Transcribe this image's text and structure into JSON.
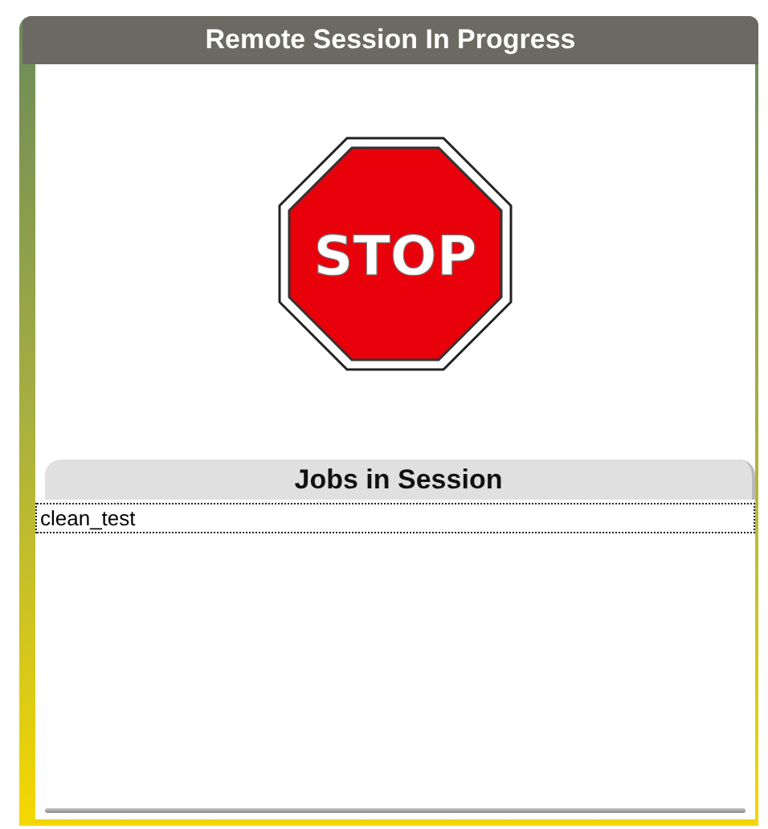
{
  "window": {
    "title": "Remote Session In Progress"
  },
  "sign": {
    "text": "STOP"
  },
  "jobs": {
    "title": "Jobs in Session",
    "rows": [
      {
        "name": "clean_test",
        "selected": true
      }
    ]
  }
}
